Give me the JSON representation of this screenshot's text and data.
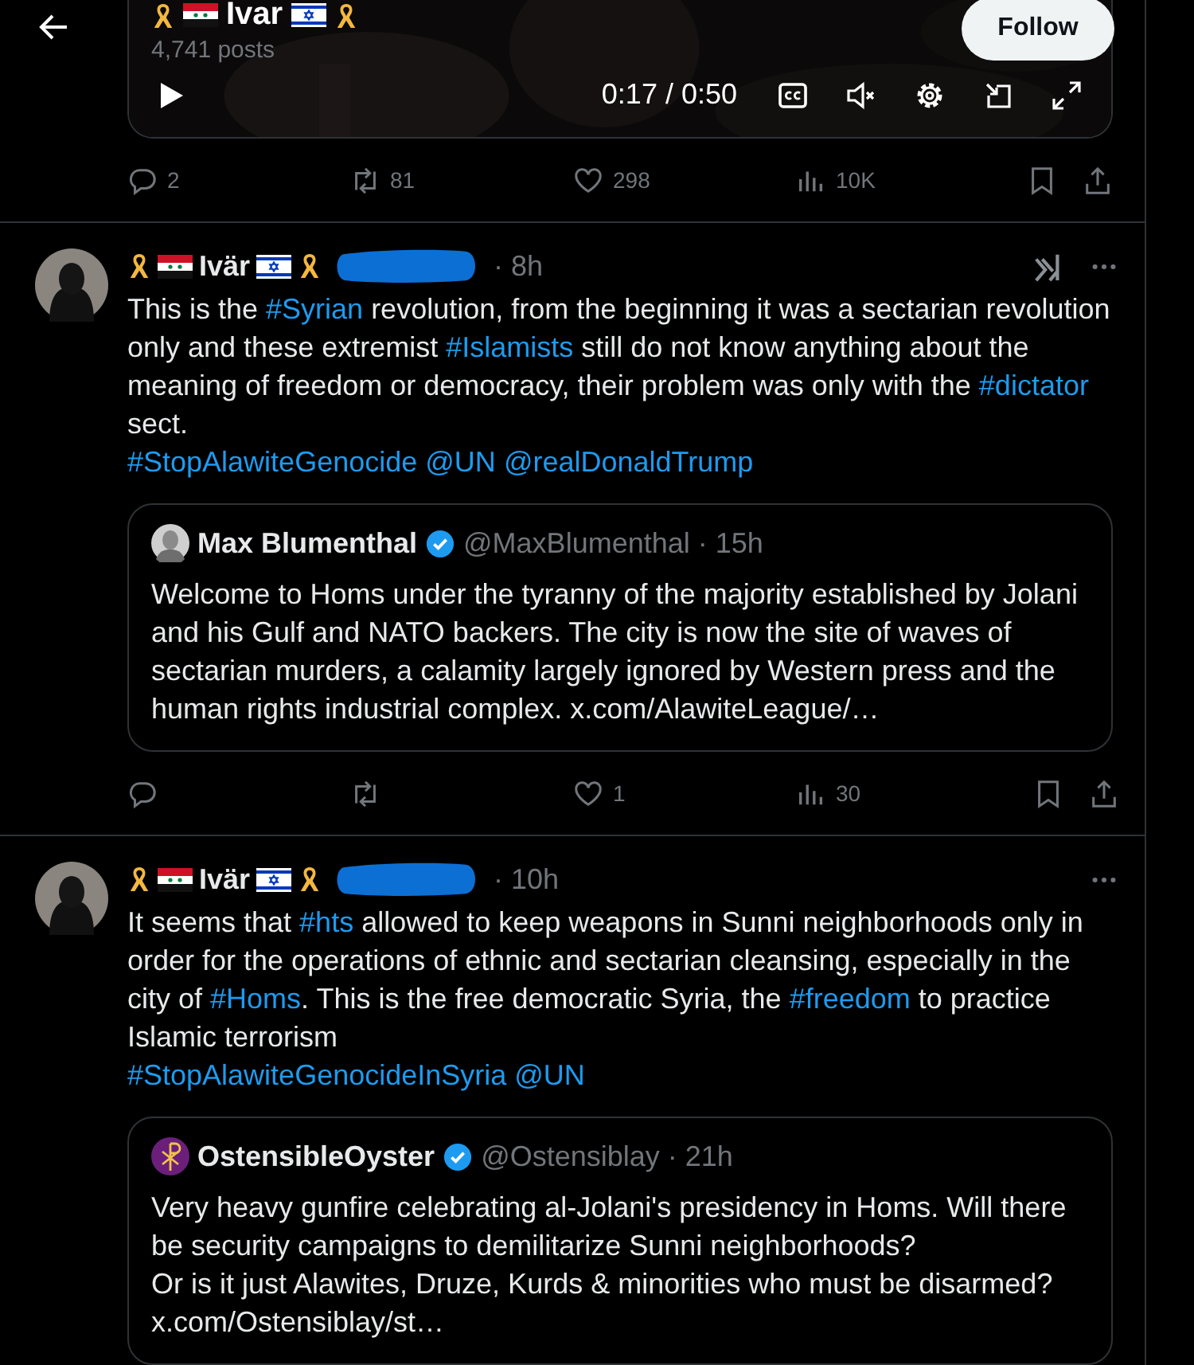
{
  "header": {
    "title": "Ivar",
    "posts": "4,741 posts",
    "follow": "Follow"
  },
  "video": {
    "time": "0:17 / 0:50",
    "muted": true
  },
  "video_post_actions": {
    "replies": "2",
    "reposts": "81",
    "likes": "298",
    "views": "10K"
  },
  "tweets": [
    {
      "author": "Ivär",
      "time": "· 8h",
      "logo_button": true,
      "text": [
        {
          "kind": "plain",
          "text": "This is the "
        },
        {
          "kind": "hashtag",
          "text": "#Syrian"
        },
        {
          "kind": "plain",
          "text": " revolution, from the beginning it was a sectarian revolution only and these extremist "
        },
        {
          "kind": "hashtag",
          "text": "#Islamists"
        },
        {
          "kind": "plain",
          "text": " still do not know anything about the meaning of freedom or democracy, their problem was only with the "
        },
        {
          "kind": "hashtag",
          "text": "#dictator"
        },
        {
          "kind": "plain",
          "text": " sect.\n"
        },
        {
          "kind": "hashtag",
          "text": "#StopAlawiteGenocide"
        },
        {
          "kind": "space"
        },
        {
          "kind": "mention",
          "text": "@UN"
        },
        {
          "kind": "space"
        },
        {
          "kind": "mention",
          "text": "@realDonaldTrump"
        }
      ],
      "quote": {
        "kind": "portrait",
        "name": "Max Blumenthal",
        "verified": true,
        "handle": "@MaxBlumenthal",
        "time": "· 15h",
        "text": "Welcome to Homs under the tyranny of the majority established by Jolani and his Gulf and NATO backers. The city is now the site of waves of sectarian murders, a calamity largely ignored by Western press and the human rights industrial complex. x.com/AlawiteLeague/…"
      },
      "actions": {
        "likes": "1",
        "views": "30"
      }
    },
    {
      "author": "Ivär",
      "time": "· 10h",
      "logo_button": false,
      "text": [
        {
          "kind": "plain",
          "text": "It seems that "
        },
        {
          "kind": "hashtag",
          "text": "#hts"
        },
        {
          "kind": "plain",
          "text": " allowed to keep weapons in Sunni neighborhoods only in order for the operations of ethnic and sectarian cleansing, especially in the city of "
        },
        {
          "kind": "hashtag",
          "text": "#Homs"
        },
        {
          "kind": "plain",
          "text": ". This is the free democratic Syria, the "
        },
        {
          "kind": "hashtag",
          "text": "#freedom"
        },
        {
          "kind": "plain",
          "text": " to practice Islamic terrorism\n"
        },
        {
          "kind": "hashtag",
          "text": "#StopAlawiteGenocideInSyria"
        },
        {
          "kind": "space"
        },
        {
          "kind": "mention",
          "text": "@UN"
        }
      ],
      "quote": {
        "kind": "emblem",
        "name": "OstensibleOyster",
        "verified": true,
        "handle": "@Ostensiblay",
        "time": "· 21h",
        "text": "Very heavy gunfire celebrating al-Jolani's presidency in Homs. Will there be security campaigns to demilitarize Sunni neighborhoods?\nOr is it just Alawites, Druze, Kurds & minorities who must be disarmed?\nx.com/Ostensiblay/st…"
      }
    }
  ]
}
